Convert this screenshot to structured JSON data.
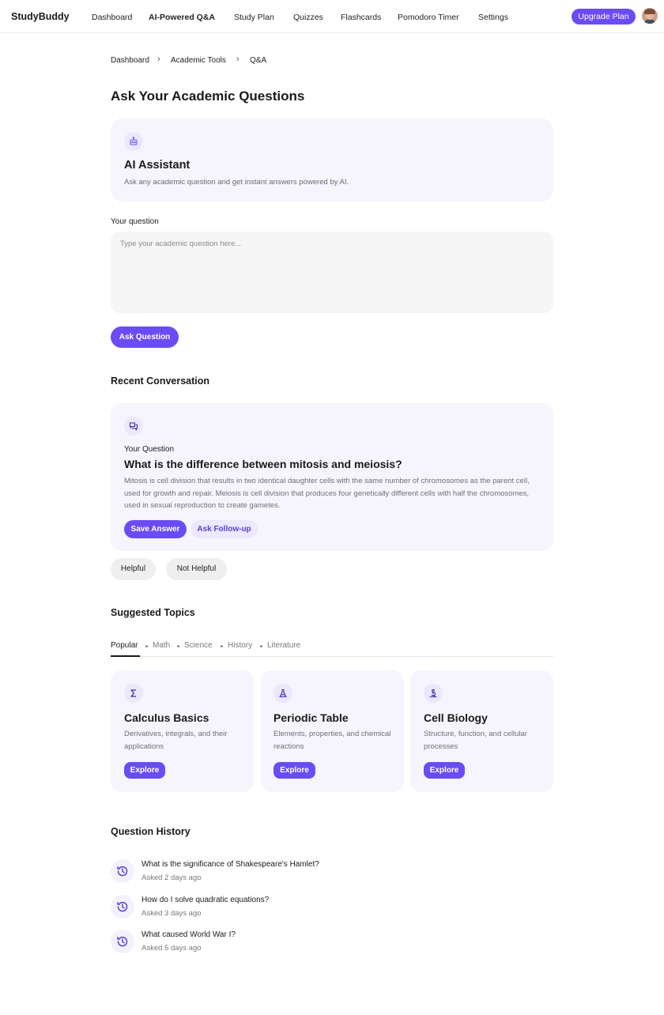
{
  "nav": {
    "brand": "StudyBuddy",
    "items": [
      "Dashboard",
      "AI-Powered Q&A",
      "Study Plan",
      "Quizzes",
      "Flashcards",
      "Pomodoro Timer",
      "Settings"
    ],
    "active": "AI-Powered Q&A",
    "upgrade_label": "Upgrade Plan"
  },
  "breadcrumb": [
    "Dashboard",
    "Academic Tools",
    "Q&A"
  ],
  "page_title": "Ask Your Academic Questions",
  "assistant": {
    "title": "AI Assistant",
    "subtitle": "Ask any academic question and get instant answers powered by AI.",
    "icon": "robot-icon"
  },
  "question_form": {
    "label": "Your question",
    "placeholder": "Type your academic question here...",
    "value": "",
    "submit_label": "Ask Question"
  },
  "recent": {
    "section_title": "Recent Conversation",
    "label": "Your Question",
    "question": "What is the difference between mitosis and meiosis?",
    "answer": "Mitosis is cell division that results in two identical daughter cells with the same number of chromosomes as the parent cell, used for growth and repair. Meiosis is cell division that produces four genetically different cells with half the chromosomes, used in sexual reproduction to create gametes.",
    "save_label": "Save Answer",
    "followup_label": "Ask Follow-up",
    "helpful_label": "Helpful",
    "not_helpful_label": "Not Helpful",
    "icon": "chat-bubbles-icon"
  },
  "suggested": {
    "section_title": "Suggested Topics",
    "tabs": [
      "Popular",
      "Math",
      "Science",
      "History",
      "Literature"
    ],
    "active_tab": "Popular",
    "cards": [
      {
        "title": "Calculus Basics",
        "description": "Derivatives, integrals, and their applications",
        "button": "Explore",
        "icon": "sigma-icon"
      },
      {
        "title": "Periodic Table",
        "description": "Elements, properties, and chemical reactions",
        "button": "Explore",
        "icon": "flask-icon"
      },
      {
        "title": "Cell Biology",
        "description": "Structure, function, and cellular processes",
        "button": "Explore",
        "icon": "microscope-icon"
      }
    ]
  },
  "history": {
    "section_title": "Question History",
    "items": [
      {
        "question": "What is the significance of Shakespeare's Hamlet?",
        "time": "Asked 2 days ago"
      },
      {
        "question": "How do I solve quadratic equations?",
        "time": "Asked 3 days ago"
      },
      {
        "question": "What caused World War I?",
        "time": "Asked 5 days ago"
      }
    ],
    "icon": "history-icon"
  },
  "colors": {
    "accent": "#6a4cf5",
    "card_bg": "#f6f5fd",
    "soft_accent": "#ece8fd"
  }
}
